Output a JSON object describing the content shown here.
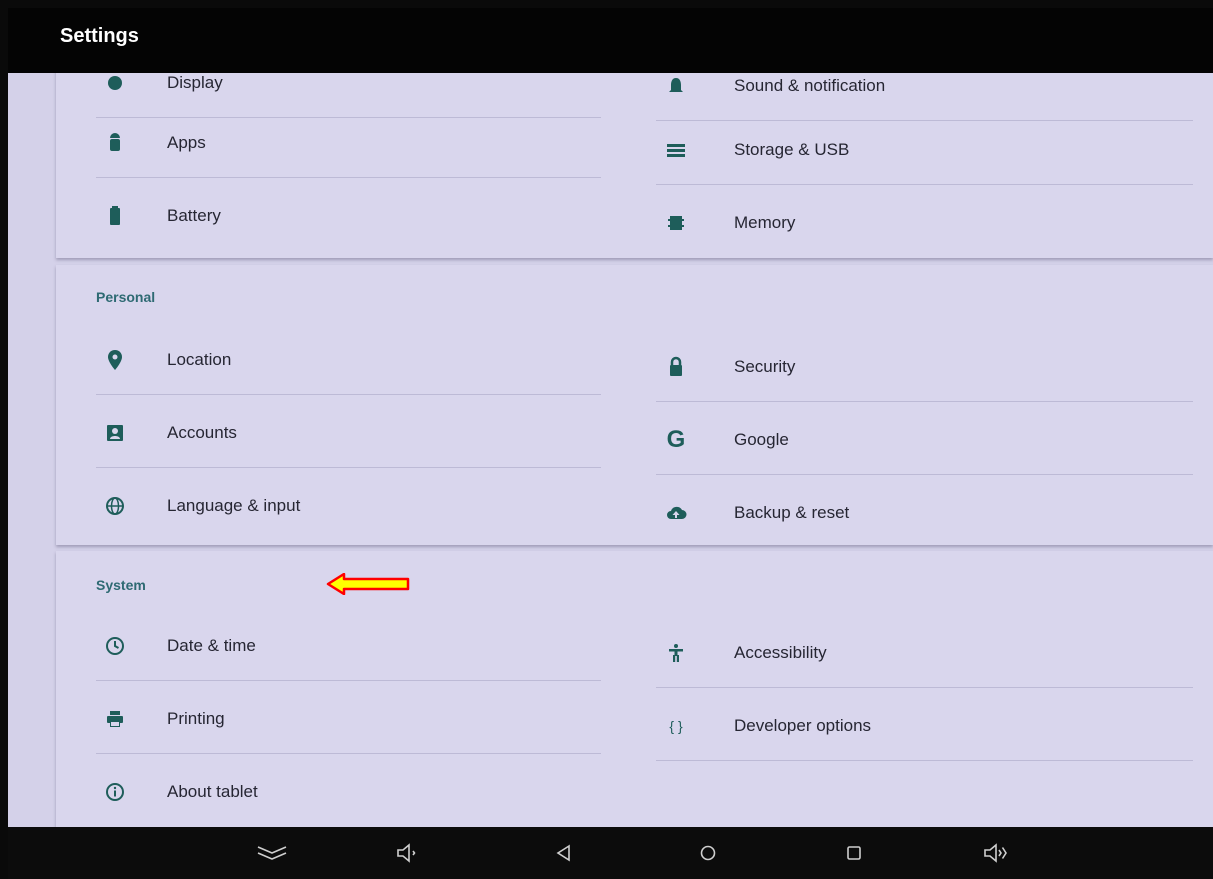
{
  "app": {
    "title": "Settings"
  },
  "device": {
    "items": [
      {
        "label": "Display",
        "icon": "brightness-icon"
      },
      {
        "label": "Sound & notification",
        "icon": "bell-icon"
      },
      {
        "label": "Apps",
        "icon": "android-icon"
      },
      {
        "label": "Storage & USB",
        "icon": "storage-icon"
      },
      {
        "label": "Battery",
        "icon": "battery-icon"
      },
      {
        "label": "Memory",
        "icon": "memory-icon"
      }
    ]
  },
  "personal": {
    "header": "Personal",
    "items": [
      {
        "label": "Location",
        "icon": "location-pin-icon"
      },
      {
        "label": "Security",
        "icon": "lock-icon"
      },
      {
        "label": "Accounts",
        "icon": "account-box-icon"
      },
      {
        "label": "Google",
        "icon": "google-icon"
      },
      {
        "label": "Language & input",
        "icon": "globe-icon"
      },
      {
        "label": "Backup & reset",
        "icon": "cloud-upload-icon"
      }
    ]
  },
  "system": {
    "header": "System",
    "items": [
      {
        "label": "Date & time",
        "icon": "clock-icon"
      },
      {
        "label": "Accessibility",
        "icon": "accessibility-icon"
      },
      {
        "label": "Printing",
        "icon": "printer-icon"
      },
      {
        "label": "Developer options",
        "icon": "braces-icon",
        "glyph": "{ }"
      },
      {
        "label": "About tablet",
        "icon": "info-icon"
      }
    ]
  },
  "google_glyph": "G",
  "colors": {
    "accent": "#2e6a73",
    "icon": "#1e5d5a",
    "annotation_arrow_fill": "#ffff00",
    "annotation_arrow_stroke": "#ff0000"
  }
}
